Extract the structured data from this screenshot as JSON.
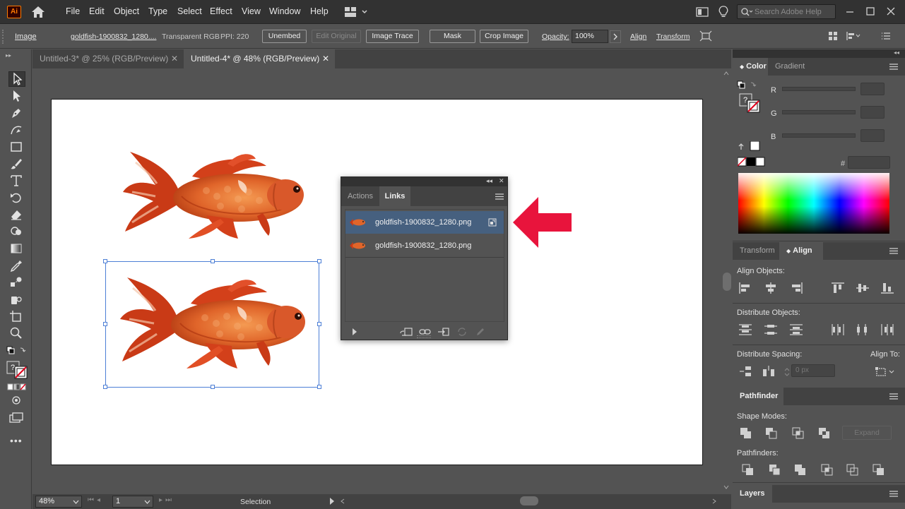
{
  "app": {
    "logo": "Ai",
    "menus": [
      "File",
      "Edit",
      "Object",
      "Type",
      "Select",
      "Effect",
      "View",
      "Window",
      "Help"
    ],
    "search_placeholder": "Search Adobe Help"
  },
  "control_bar": {
    "object_type": "Image",
    "file_name": "goldfish-1900832_1280....",
    "color_mode": "Transparent RGB",
    "ppi": "PPI: 220",
    "unembed": "Unembed",
    "edit_original": "Edit Original",
    "image_trace": "Image Trace",
    "mask": "Mask",
    "crop_image": "Crop Image",
    "opacity_label": "Opacity:",
    "opacity_value": "100%",
    "align": "Align",
    "transform": "Transform"
  },
  "tabs": [
    {
      "label": "Untitled-3* @ 25% (RGB/Preview)",
      "active": false
    },
    {
      "label": "Untitled-4* @ 48% (RGB/Preview)",
      "active": true
    }
  ],
  "links_panel": {
    "tabs": [
      "Actions",
      "Links"
    ],
    "active_tab": "Links",
    "items": [
      {
        "name": "goldfish-1900832_1280.png",
        "selected": true
      },
      {
        "name": "goldfish-1900832_1280.png",
        "selected": false
      }
    ]
  },
  "color_panel": {
    "tabs": [
      "Color",
      "Gradient"
    ],
    "channels": [
      "R",
      "G",
      "B"
    ],
    "hex_prefix": "#"
  },
  "align_panel": {
    "tabs": [
      "Transform",
      "Align"
    ],
    "align_objects": "Align Objects:",
    "distribute_objects": "Distribute Objects:",
    "distribute_spacing": "Distribute Spacing:",
    "align_to": "Align To:",
    "spacing_value": "0 px"
  },
  "pathfinder_panel": {
    "title": "Pathfinder",
    "shape_modes": "Shape Modes:",
    "expand": "Expand",
    "pathfinders": "Pathfinders:"
  },
  "layers_panel": {
    "title": "Layers"
  },
  "status_bar": {
    "zoom": "48%",
    "artboard": "1",
    "tool": "Selection"
  },
  "colors": {
    "accent": "#46607f",
    "arrow": "#e8143c",
    "selection": "#4d7fd6"
  }
}
